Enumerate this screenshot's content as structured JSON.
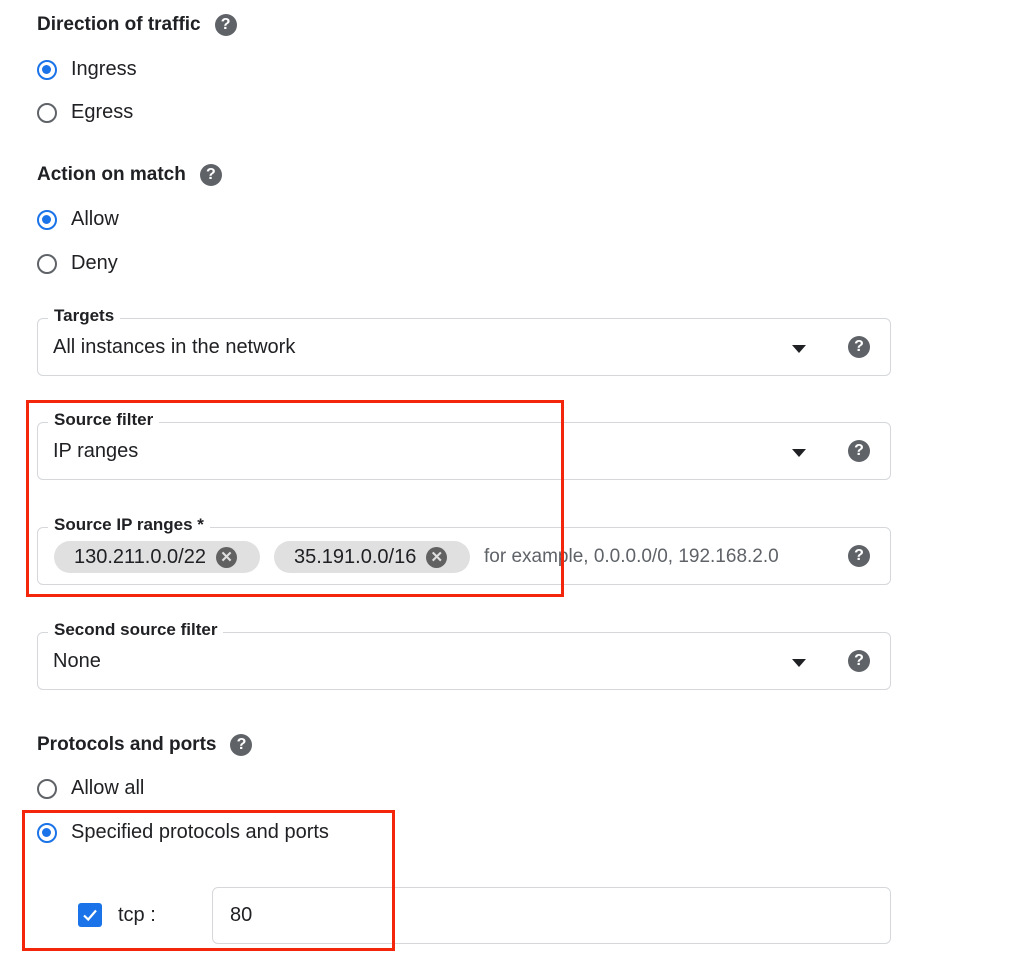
{
  "direction": {
    "title": "Direction of traffic",
    "options": [
      {
        "label": "Ingress",
        "checked": true
      },
      {
        "label": "Egress",
        "checked": false
      }
    ]
  },
  "action": {
    "title": "Action on match",
    "options": [
      {
        "label": "Allow",
        "checked": true
      },
      {
        "label": "Deny",
        "checked": false
      }
    ]
  },
  "targets": {
    "label": "Targets",
    "value": "All instances in the network"
  },
  "source_filter": {
    "label": "Source filter",
    "value": "IP ranges"
  },
  "source_ip_ranges": {
    "label": "Source IP ranges *",
    "chips": [
      "130.211.0.0/22",
      "35.191.0.0/16"
    ],
    "placeholder": "for example, 0.0.0.0/0, 192.168.2.0"
  },
  "second_source_filter": {
    "label": "Second source filter",
    "value": "None"
  },
  "protocols": {
    "title": "Protocols and ports",
    "options": [
      {
        "label": "Allow all",
        "checked": false
      },
      {
        "label": "Specified protocols and ports",
        "checked": true
      }
    ],
    "tcp": {
      "label": "tcp :",
      "checked": true,
      "value": "80"
    }
  },
  "icons": {
    "help": "?",
    "chip_remove": "✕"
  },
  "colors": {
    "accent": "#1a73e8",
    "highlight": "#f3250b"
  }
}
